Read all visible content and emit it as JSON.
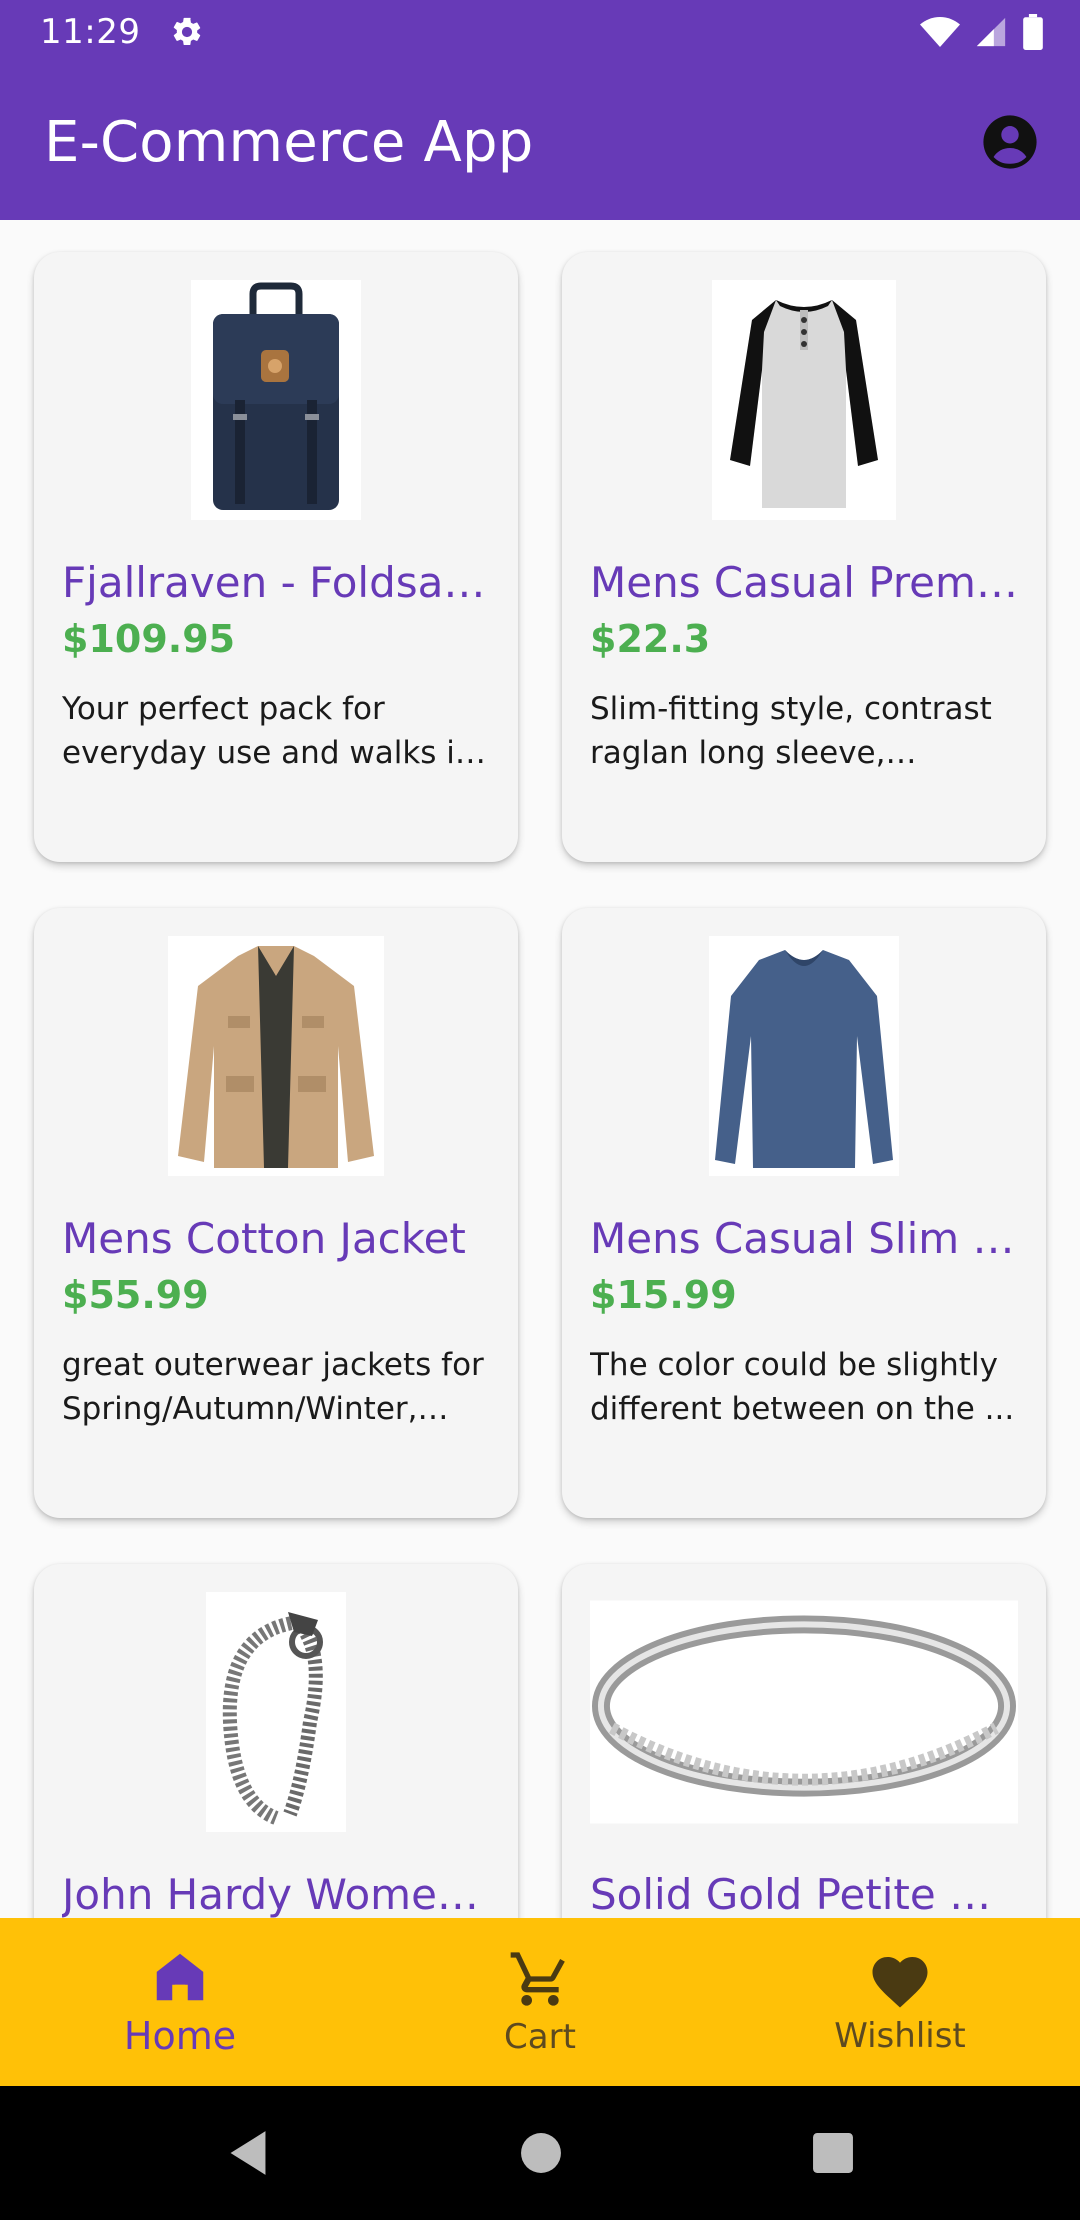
{
  "status_bar": {
    "time": "11:29",
    "icons": [
      "settings-icon",
      "wifi-icon",
      "signal-icon",
      "battery-icon"
    ]
  },
  "app_bar": {
    "title": "E-Commerce App",
    "account_icon": "account-circle-icon"
  },
  "products": [
    {
      "title": "Fjallraven - Foldsac...",
      "price": "$109.95",
      "description": "Your perfect pack for everyday use and walks in ...",
      "image": "backpack"
    },
    {
      "title": "Mens Casual Premi...",
      "price": "$22.3",
      "description": "Slim-fitting style, contrast raglan long sleeve, three-...",
      "image": "raglan-shirt"
    },
    {
      "title": "Mens Cotton Jacket",
      "price": "$55.99",
      "description": "great outerwear jackets for Spring/Autumn/Winter, su...",
      "image": "jacket"
    },
    {
      "title": "Mens Casual Slim Fit",
      "price": "$15.99",
      "description": "The color could be slightly different between on the ...",
      "image": "long-sleeve-tee"
    },
    {
      "title": "John Hardy Women...",
      "price": "",
      "description": "",
      "image": "bracelet"
    },
    {
      "title": "Solid Gold Petite Mi...",
      "price": "",
      "description": "",
      "image": "ring"
    }
  ],
  "bottom_nav": {
    "items": [
      {
        "label": "Home",
        "icon": "home-icon",
        "active": true
      },
      {
        "label": "Cart",
        "icon": "cart-icon",
        "active": false
      },
      {
        "label": "Wishlist",
        "icon": "heart-icon",
        "active": false
      }
    ]
  },
  "colors": {
    "primary": "#673AB7",
    "accent": "#FFC107",
    "price": "#4CAF50"
  }
}
